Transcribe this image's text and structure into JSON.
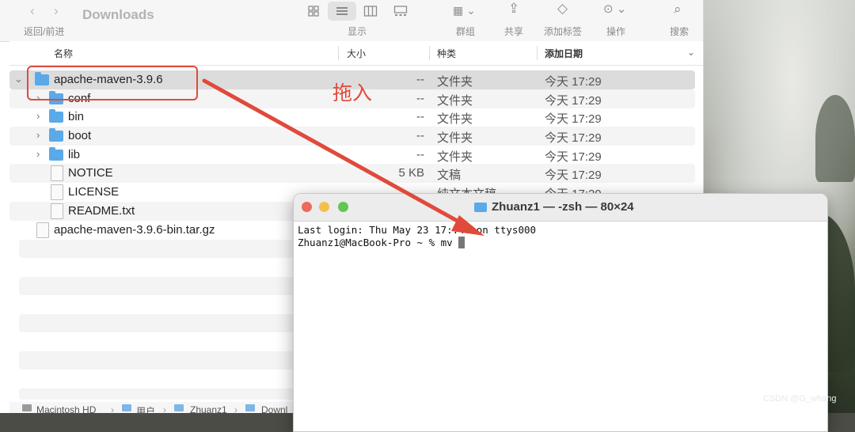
{
  "toolbar": {
    "title": "Downloads",
    "nav_label": "返回/前进",
    "view_label": "显示",
    "group_label": "群组",
    "share_label": "共享",
    "tag_label": "添加标签",
    "action_label": "操作",
    "search_label": "搜索"
  },
  "columns": {
    "name": "名称",
    "size": "大小",
    "kind": "种类",
    "date": "添加日期"
  },
  "files": [
    {
      "name": "apache-maven-3.9.6",
      "size": "--",
      "kind": "文件夹",
      "date": "今天 17:29",
      "type": "folder"
    },
    {
      "name": "conf",
      "size": "--",
      "kind": "文件夹",
      "date": "今天 17:29",
      "type": "folder"
    },
    {
      "name": "bin",
      "size": "--",
      "kind": "文件夹",
      "date": "今天 17:29",
      "type": "folder"
    },
    {
      "name": "boot",
      "size": "--",
      "kind": "文件夹",
      "date": "今天 17:29",
      "type": "folder"
    },
    {
      "name": "lib",
      "size": "--",
      "kind": "文件夹",
      "date": "今天 17:29",
      "type": "folder"
    },
    {
      "name": "NOTICE",
      "size": "5 KB",
      "kind": "文稿",
      "date": "今天 17:29",
      "type": "doc"
    },
    {
      "name": "LICENSE",
      "size": "",
      "kind": "纯文本文稿",
      "date": "今天 17:29",
      "type": "txt"
    },
    {
      "name": "README.txt",
      "size": "",
      "kind": "",
      "date": "",
      "type": "txt"
    },
    {
      "name": "apache-maven-3.9.6-bin.tar.gz",
      "size": "",
      "kind": "",
      "date": "",
      "type": "archive"
    }
  ],
  "pathbar": [
    "Macintosh HD",
    "用户",
    "Zhuanz1",
    "Downl"
  ],
  "annotation": {
    "drag_label": "拖入",
    "accent": "#e04a3a"
  },
  "terminal": {
    "title": "Zhuanz1 — -zsh — 80×24",
    "line1": "Last login: Thu May 23 17:",
    "line1_end": ":46 on ttys000",
    "line2": "Zhuanz1@MacBook-Pro ~ % mv "
  },
  "watermark": "CSDN @G_whang"
}
